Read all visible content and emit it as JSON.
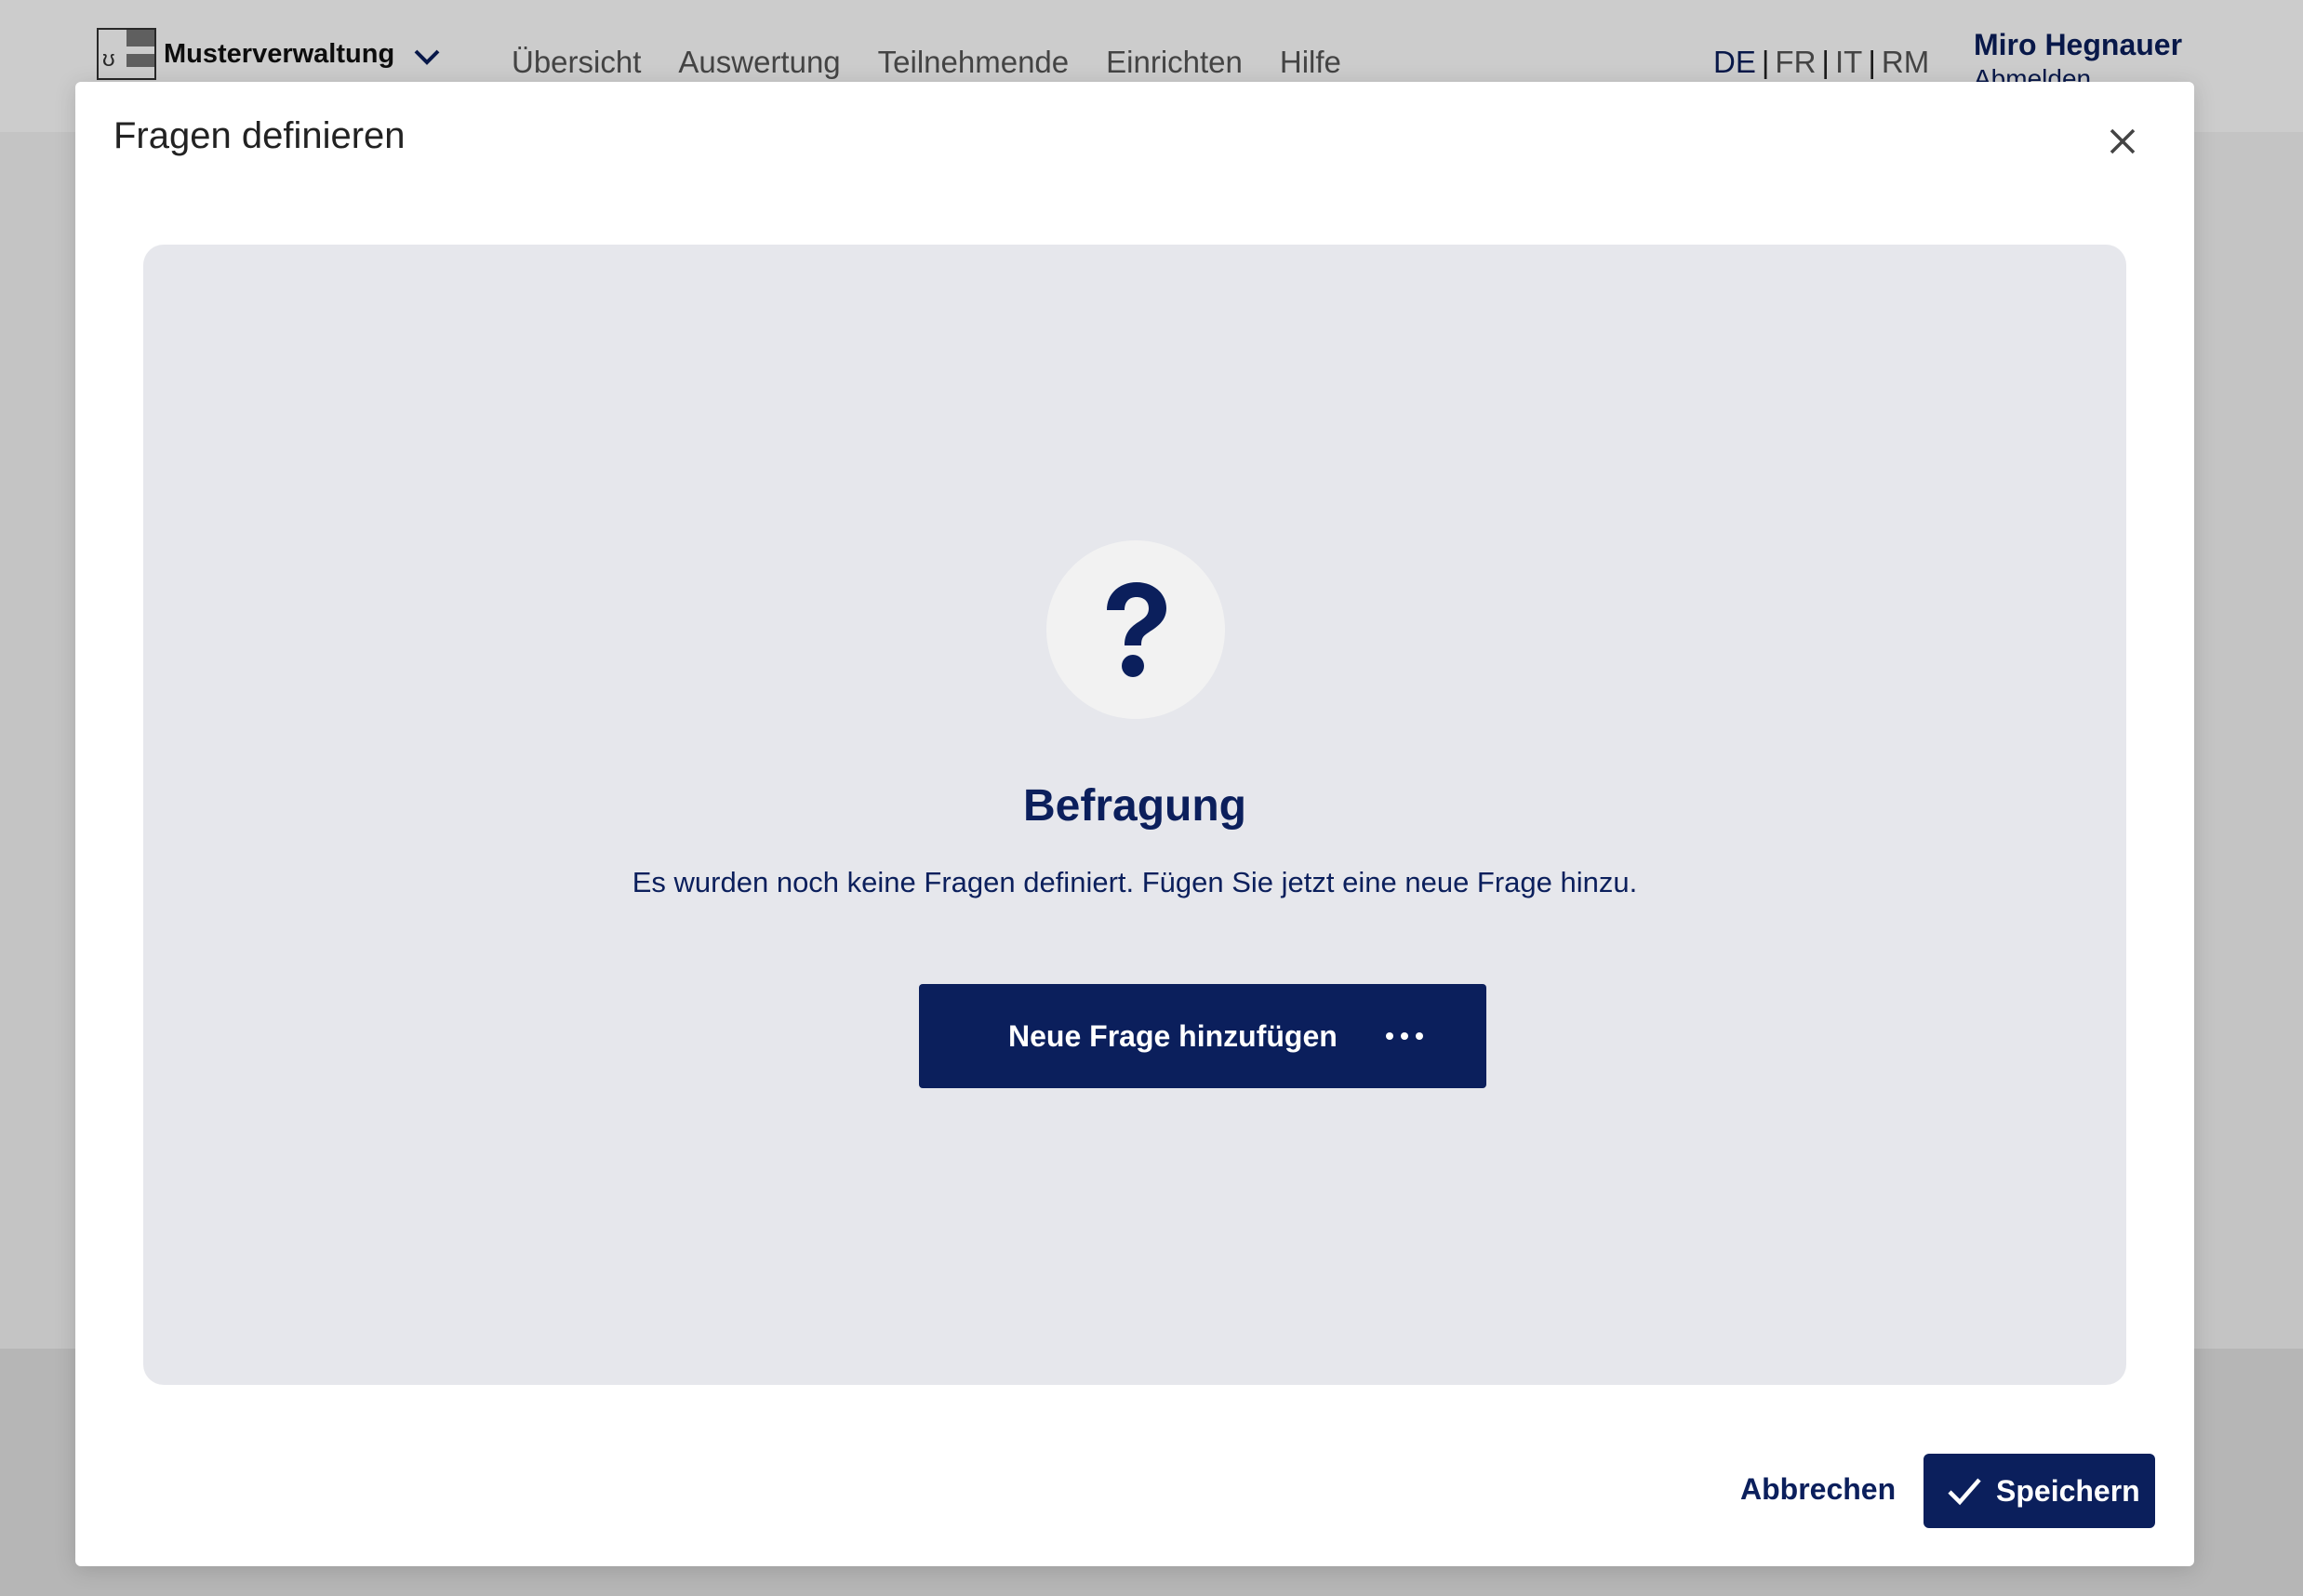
{
  "app": {
    "logo_text": "Musterverwaltung",
    "nav": [
      "Übersicht",
      "Auswertung",
      "Teilnehmende",
      "Einrichten",
      "Hilfe"
    ],
    "languages": {
      "active": "DE",
      "others": [
        "FR",
        "IT",
        "RM"
      ],
      "separator": "|"
    },
    "user": {
      "name": "Miro Hegnauer",
      "logout_label": "Abmelden"
    }
  },
  "modal": {
    "title": "Fragen definieren",
    "empty_state": {
      "title": "Befragung",
      "text": "Es wurden noch keine Fragen definiert. Fügen Sie jetzt eine neue Frage hinzu.",
      "icon": "question-mark-icon"
    },
    "add_button_label": "Neue Frage hinzufügen",
    "cancel_label": "Abbrechen",
    "save_label": "Speichern"
  },
  "colors": {
    "primary": "#0b1f5c",
    "panel_bg": "#e6e7ec",
    "overlay": "rgba(0,0,0,0.2)"
  }
}
